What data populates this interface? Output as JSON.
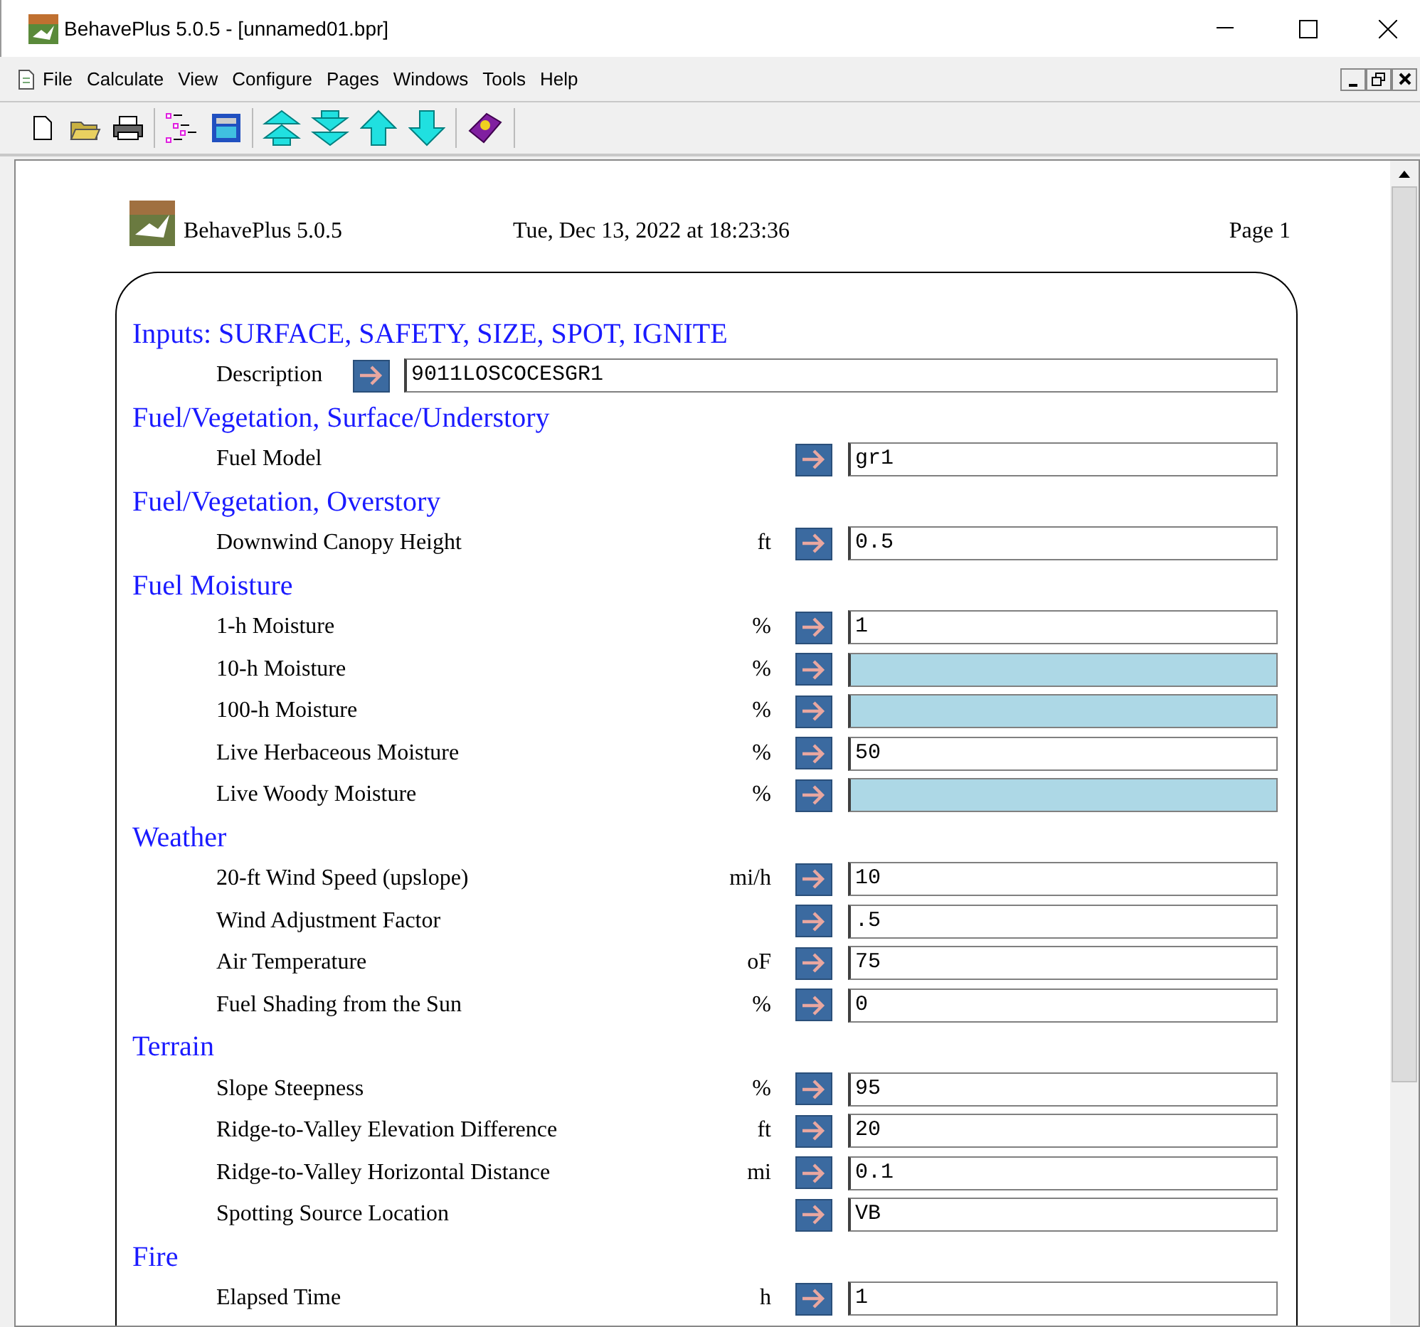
{
  "window": {
    "title": "BehavePlus 5.0.5 - [unnamed01.bpr]"
  },
  "menu": [
    "File",
    "Calculate",
    "View",
    "Configure",
    "Pages",
    "Windows",
    "Tools",
    "Help"
  ],
  "page_header": {
    "app": "BehavePlus 5.0.5",
    "date": "Tue, Dec 13, 2022 at 18:23:36",
    "page": "Page 1"
  },
  "groups": [
    {
      "heading": "Inputs: SURFACE, SAFETY, SIZE, SPOT, IGNITE",
      "rows": [
        {
          "kind": "wide",
          "label": "Description",
          "value": "9011LOSCOCESGR1",
          "needs_input": false
        }
      ]
    },
    {
      "heading": "Fuel/Vegetation, Surface/Understory",
      "rows": [
        {
          "kind": "field",
          "label": "Fuel Model",
          "value": "gr1",
          "needs_input": false
        }
      ]
    },
    {
      "heading": "Fuel/Vegetation, Overstory",
      "rows": [
        {
          "kind": "field",
          "label": "Downwind Canopy Height",
          "unit": "ft",
          "value": "0.5",
          "needs_input": false
        }
      ]
    },
    {
      "heading": "Fuel Moisture",
      "rows": [
        {
          "kind": "field",
          "label": "1-h Moisture",
          "unit": "%",
          "value": "1",
          "needs_input": false
        },
        {
          "kind": "field",
          "label": "10-h Moisture",
          "unit": "%",
          "needs_input": true
        },
        {
          "kind": "field",
          "label": "100-h Moisture",
          "unit": "%",
          "needs_input": true
        },
        {
          "kind": "field",
          "label": "Live Herbaceous Moisture",
          "unit": "%",
          "value": "50",
          "needs_input": false
        },
        {
          "kind": "field",
          "label": "Live Woody Moisture",
          "unit": "%",
          "needs_input": true
        }
      ]
    },
    {
      "heading": "Weather",
      "rows": [
        {
          "kind": "field",
          "label": "20-ft Wind Speed (upslope)",
          "unit": "mi/h",
          "value": "10",
          "needs_input": false
        },
        {
          "kind": "field",
          "label": "Wind Adjustment Factor",
          "value": ".5",
          "needs_input": false
        },
        {
          "kind": "field",
          "label": "Air Temperature",
          "unit": "oF",
          "value": "75",
          "needs_input": false
        },
        {
          "kind": "field",
          "label": "Fuel Shading from the Sun",
          "unit": "%",
          "value": "0",
          "needs_input": false
        }
      ]
    },
    {
      "heading": "Terrain",
      "rows": [
        {
          "kind": "field",
          "label": "Slope Steepness",
          "unit": "%",
          "value": "95",
          "needs_input": false
        },
        {
          "kind": "field",
          "label": "Ridge-to-Valley Elevation Difference",
          "unit": "ft",
          "value": "20",
          "needs_input": false
        },
        {
          "kind": "field",
          "label": "Ridge-to-Valley Horizontal Distance",
          "unit": "mi",
          "value": "0.1",
          "needs_input": false
        },
        {
          "kind": "field",
          "label": "Spotting Source Location",
          "value": "VB",
          "needs_input": false
        }
      ]
    },
    {
      "heading": "Fire",
      "rows": [
        {
          "kind": "field",
          "label": "Elapsed Time",
          "unit": "h",
          "value": "1",
          "needs_input": false
        }
      ]
    }
  ]
}
